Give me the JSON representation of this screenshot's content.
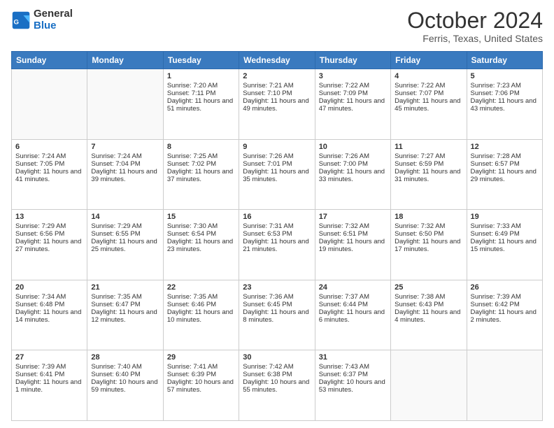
{
  "header": {
    "logo_line1": "General",
    "logo_line2": "Blue",
    "title": "October 2024",
    "location": "Ferris, Texas, United States"
  },
  "days_of_week": [
    "Sunday",
    "Monday",
    "Tuesday",
    "Wednesday",
    "Thursday",
    "Friday",
    "Saturday"
  ],
  "weeks": [
    [
      {
        "day": "",
        "info": ""
      },
      {
        "day": "",
        "info": ""
      },
      {
        "day": "1",
        "info": "Sunrise: 7:20 AM\nSunset: 7:11 PM\nDaylight: 11 hours and 51 minutes."
      },
      {
        "day": "2",
        "info": "Sunrise: 7:21 AM\nSunset: 7:10 PM\nDaylight: 11 hours and 49 minutes."
      },
      {
        "day": "3",
        "info": "Sunrise: 7:22 AM\nSunset: 7:09 PM\nDaylight: 11 hours and 47 minutes."
      },
      {
        "day": "4",
        "info": "Sunrise: 7:22 AM\nSunset: 7:07 PM\nDaylight: 11 hours and 45 minutes."
      },
      {
        "day": "5",
        "info": "Sunrise: 7:23 AM\nSunset: 7:06 PM\nDaylight: 11 hours and 43 minutes."
      }
    ],
    [
      {
        "day": "6",
        "info": "Sunrise: 7:24 AM\nSunset: 7:05 PM\nDaylight: 11 hours and 41 minutes."
      },
      {
        "day": "7",
        "info": "Sunrise: 7:24 AM\nSunset: 7:04 PM\nDaylight: 11 hours and 39 minutes."
      },
      {
        "day": "8",
        "info": "Sunrise: 7:25 AM\nSunset: 7:02 PM\nDaylight: 11 hours and 37 minutes."
      },
      {
        "day": "9",
        "info": "Sunrise: 7:26 AM\nSunset: 7:01 PM\nDaylight: 11 hours and 35 minutes."
      },
      {
        "day": "10",
        "info": "Sunrise: 7:26 AM\nSunset: 7:00 PM\nDaylight: 11 hours and 33 minutes."
      },
      {
        "day": "11",
        "info": "Sunrise: 7:27 AM\nSunset: 6:59 PM\nDaylight: 11 hours and 31 minutes."
      },
      {
        "day": "12",
        "info": "Sunrise: 7:28 AM\nSunset: 6:57 PM\nDaylight: 11 hours and 29 minutes."
      }
    ],
    [
      {
        "day": "13",
        "info": "Sunrise: 7:29 AM\nSunset: 6:56 PM\nDaylight: 11 hours and 27 minutes."
      },
      {
        "day": "14",
        "info": "Sunrise: 7:29 AM\nSunset: 6:55 PM\nDaylight: 11 hours and 25 minutes."
      },
      {
        "day": "15",
        "info": "Sunrise: 7:30 AM\nSunset: 6:54 PM\nDaylight: 11 hours and 23 minutes."
      },
      {
        "day": "16",
        "info": "Sunrise: 7:31 AM\nSunset: 6:53 PM\nDaylight: 11 hours and 21 minutes."
      },
      {
        "day": "17",
        "info": "Sunrise: 7:32 AM\nSunset: 6:51 PM\nDaylight: 11 hours and 19 minutes."
      },
      {
        "day": "18",
        "info": "Sunrise: 7:32 AM\nSunset: 6:50 PM\nDaylight: 11 hours and 17 minutes."
      },
      {
        "day": "19",
        "info": "Sunrise: 7:33 AM\nSunset: 6:49 PM\nDaylight: 11 hours and 15 minutes."
      }
    ],
    [
      {
        "day": "20",
        "info": "Sunrise: 7:34 AM\nSunset: 6:48 PM\nDaylight: 11 hours and 14 minutes."
      },
      {
        "day": "21",
        "info": "Sunrise: 7:35 AM\nSunset: 6:47 PM\nDaylight: 11 hours and 12 minutes."
      },
      {
        "day": "22",
        "info": "Sunrise: 7:35 AM\nSunset: 6:46 PM\nDaylight: 11 hours and 10 minutes."
      },
      {
        "day": "23",
        "info": "Sunrise: 7:36 AM\nSunset: 6:45 PM\nDaylight: 11 hours and 8 minutes."
      },
      {
        "day": "24",
        "info": "Sunrise: 7:37 AM\nSunset: 6:44 PM\nDaylight: 11 hours and 6 minutes."
      },
      {
        "day": "25",
        "info": "Sunrise: 7:38 AM\nSunset: 6:43 PM\nDaylight: 11 hours and 4 minutes."
      },
      {
        "day": "26",
        "info": "Sunrise: 7:39 AM\nSunset: 6:42 PM\nDaylight: 11 hours and 2 minutes."
      }
    ],
    [
      {
        "day": "27",
        "info": "Sunrise: 7:39 AM\nSunset: 6:41 PM\nDaylight: 11 hours and 1 minute."
      },
      {
        "day": "28",
        "info": "Sunrise: 7:40 AM\nSunset: 6:40 PM\nDaylight: 10 hours and 59 minutes."
      },
      {
        "day": "29",
        "info": "Sunrise: 7:41 AM\nSunset: 6:39 PM\nDaylight: 10 hours and 57 minutes."
      },
      {
        "day": "30",
        "info": "Sunrise: 7:42 AM\nSunset: 6:38 PM\nDaylight: 10 hours and 55 minutes."
      },
      {
        "day": "31",
        "info": "Sunrise: 7:43 AM\nSunset: 6:37 PM\nDaylight: 10 hours and 53 minutes."
      },
      {
        "day": "",
        "info": ""
      },
      {
        "day": "",
        "info": ""
      }
    ]
  ]
}
